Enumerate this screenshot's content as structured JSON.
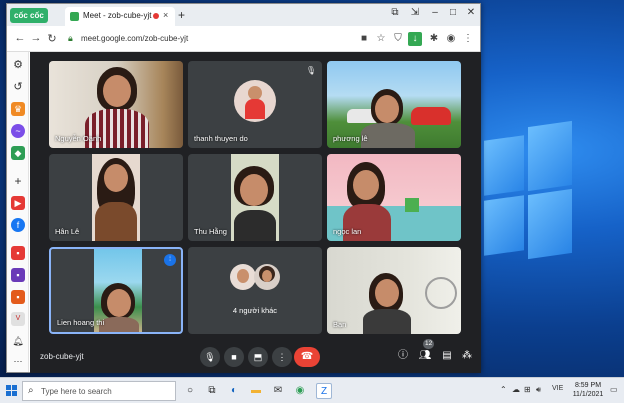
{
  "browser": {
    "brand": "cốc cốc",
    "tab_title": "Meet - zob-cube-yjt",
    "tab_close": "×",
    "new_tab": "+",
    "url": "meet.google.com/zob-cube-yjt"
  },
  "meeting": {
    "code": "zob-cube-yjt",
    "people_count": "12",
    "tiles": [
      {
        "name": "Nguyễn Oanh"
      },
      {
        "name": "thanh thuyen do"
      },
      {
        "name": "phương lê"
      },
      {
        "name": "Hân Lê"
      },
      {
        "name": "Thu Hằng"
      },
      {
        "name": "ngọc lan"
      },
      {
        "name": "Lien hoang thi"
      },
      {
        "name": "4 người khác"
      },
      {
        "name": "Bạn"
      }
    ]
  },
  "taskbar": {
    "search_placeholder": "Type here to search",
    "language": "VIE",
    "time": "8:59 PM",
    "date": "11/1/2021"
  },
  "colors": {
    "meet_bg": "#202124",
    "tile_bg": "#3c4043",
    "hangup": "#ea4335",
    "active_speaker": "#1a73e8",
    "coccoc_green": "#2fb06a"
  }
}
